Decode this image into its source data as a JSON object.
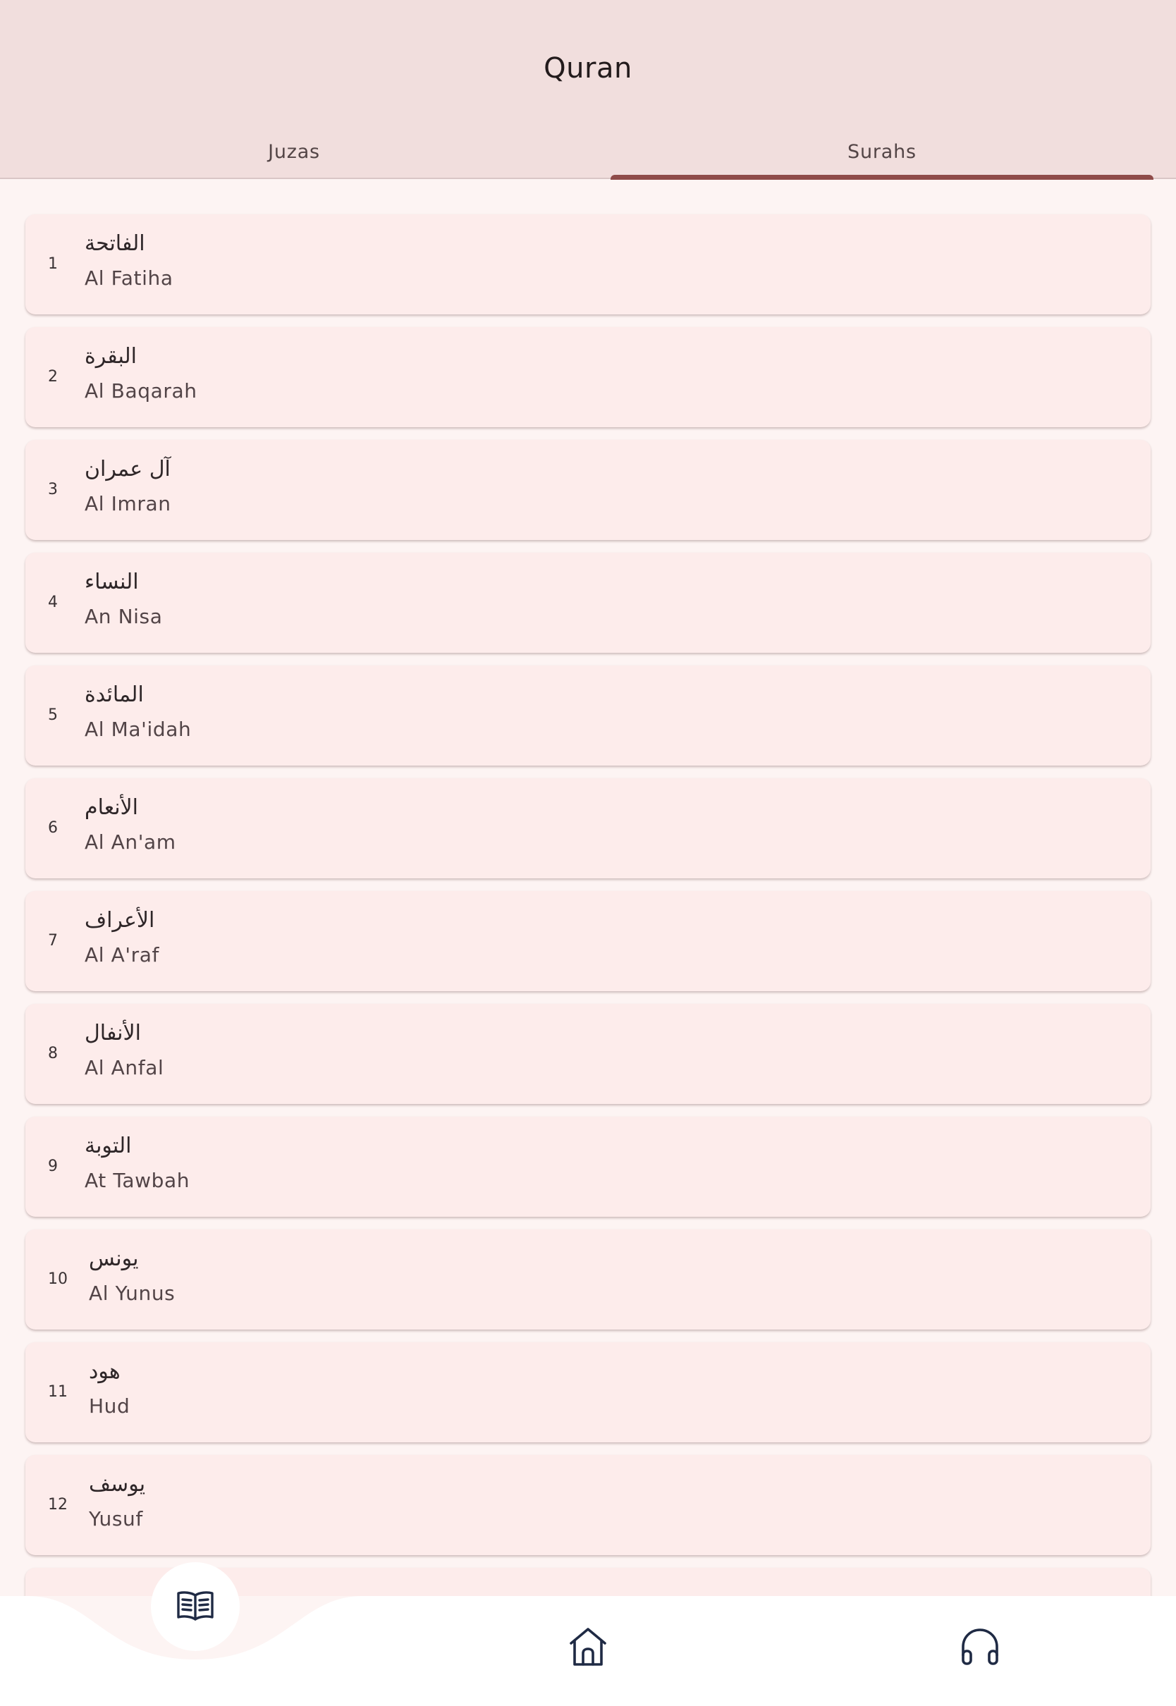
{
  "app": {
    "title": "Quran"
  },
  "tabs": [
    {
      "label": "Juzas",
      "selected": false
    },
    {
      "label": "Surahs",
      "selected": true
    }
  ],
  "surahs": [
    {
      "number": "1",
      "arabic": "الفاتحة",
      "name": "Al Fatiha"
    },
    {
      "number": "2",
      "arabic": "البقرة",
      "name": "Al Baqarah"
    },
    {
      "number": "3",
      "arabic": "آل عمران",
      "name": "Al Imran"
    },
    {
      "number": "4",
      "arabic": "النساء",
      "name": "An Nisa"
    },
    {
      "number": "5",
      "arabic": "المائدة",
      "name": "Al Ma'idah"
    },
    {
      "number": "6",
      "arabic": "الأنعام",
      "name": "Al An'am"
    },
    {
      "number": "7",
      "arabic": "الأعراف",
      "name": "Al A'raf"
    },
    {
      "number": "8",
      "arabic": "الأنفال",
      "name": "Al Anfal"
    },
    {
      "number": "9",
      "arabic": "التوبة",
      "name": "At Tawbah"
    },
    {
      "number": "10",
      "arabic": "يونس",
      "name": "Al Yunus"
    },
    {
      "number": "11",
      "arabic": "هود",
      "name": "Hud"
    },
    {
      "number": "12",
      "arabic": "يوسف",
      "name": "Yusuf"
    },
    {
      "number": "13",
      "arabic": "",
      "name": ""
    }
  ],
  "bottom_nav": {
    "items": [
      {
        "icon": "open-book-icon",
        "active": true
      },
      {
        "icon": "home-icon",
        "active": false
      },
      {
        "icon": "headphones-icon",
        "active": false
      }
    ]
  },
  "colors": {
    "appbar_bg": "#f1dedd",
    "page_bg": "#fdf4f3",
    "card_bg": "#fdeceb",
    "tab_indicator": "#8f4b49",
    "icon": "#1f2a44"
  }
}
